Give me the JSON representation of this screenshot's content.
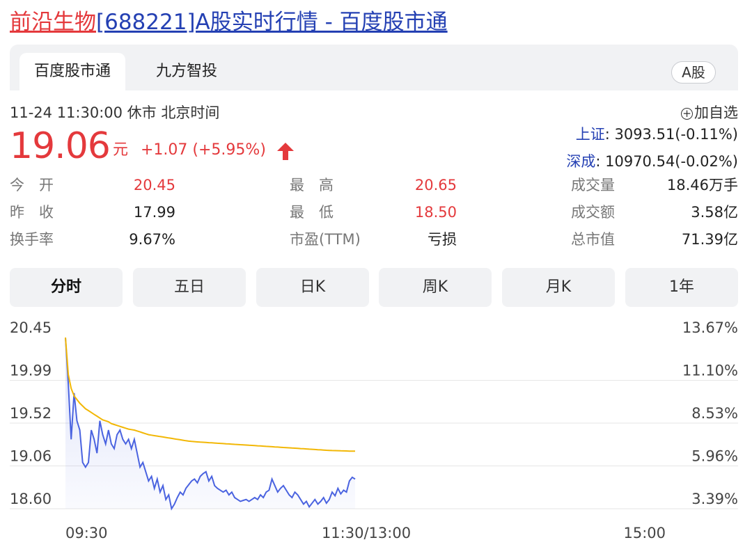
{
  "page": {
    "title_stock": "前沿生物",
    "title_rest": "[688221]A股实时行情 - 百度股市通"
  },
  "tabs": [
    {
      "label": "百度股市通",
      "active": true
    },
    {
      "label": "九方智投",
      "active": false
    }
  ],
  "market_badge": "A股",
  "quote": {
    "status_line": "11-24 11:30:00  休市  北京时间",
    "price": "19.06",
    "unit": "元",
    "change": "+1.07 (+5.95%)",
    "direction_icon": "arrow-up-icon",
    "add_watchlist": "加自选"
  },
  "indices": [
    {
      "name": "上证",
      "value": ": 3093.51(-0.11%)"
    },
    {
      "name": "深成",
      "value": ": 10970.54(-0.02%)"
    }
  ],
  "stats": [
    {
      "label": "今　开",
      "value": "20.45",
      "color": "red"
    },
    {
      "label": "最　高",
      "value": "20.65",
      "color": "red"
    },
    {
      "label": "成交量",
      "value": "18.46万手",
      "color": "black"
    },
    {
      "label": "昨　收",
      "value": "17.99",
      "color": "black"
    },
    {
      "label": "最　低",
      "value": "18.50",
      "color": "red"
    },
    {
      "label": "成交额",
      "value": "3.58亿",
      "color": "black"
    },
    {
      "label": "换手率",
      "value": "9.67%",
      "color": "black"
    },
    {
      "label": "市盈(TTM)",
      "value": "亏损",
      "color": "black"
    },
    {
      "label": "总市值",
      "value": "71.39亿",
      "color": "black"
    }
  ],
  "periods": [
    "分时",
    "五日",
    "日K",
    "周K",
    "月K",
    "1年"
  ],
  "active_period": "分时",
  "colors": {
    "up": "#e4393c",
    "price_line": "#4a63e0",
    "avg_line": "#f2b705",
    "link_blue": "#2440b3"
  },
  "chart_data": {
    "type": "line",
    "y_ticks": [
      "20.45",
      "19.99",
      "19.52",
      "19.06",
      "18.60"
    ],
    "y_pct_ticks": [
      "13.67%",
      "11.10%",
      "8.53%",
      "5.96%",
      "3.39%"
    ],
    "x_ticks": [
      "09:30",
      "11:30/13:00",
      "15:00"
    ],
    "ylim": [
      18.6,
      20.45
    ],
    "prev_close": 17.99,
    "series": [
      {
        "role": "price",
        "values": [
          20.45,
          19.95,
          19.35,
          19.85,
          19.55,
          19.45,
          19.1,
          19.05,
          19.1,
          19.45,
          19.35,
          19.2,
          19.55,
          19.4,
          19.3,
          19.45,
          19.3,
          19.25,
          19.4,
          19.45,
          19.35,
          19.3,
          19.35,
          19.25,
          19.35,
          19.2,
          19.05,
          19.1,
          19.0,
          18.9,
          18.95,
          18.82,
          18.92,
          18.78,
          18.85,
          18.7,
          18.75,
          18.6,
          18.65,
          18.72,
          18.78,
          18.75,
          18.82,
          18.86,
          18.9,
          18.92,
          18.88,
          18.95,
          18.98,
          19.0,
          18.9,
          18.95,
          18.85,
          18.82,
          18.8,
          18.78,
          18.8,
          18.75,
          18.78,
          18.72,
          18.7,
          18.68,
          18.69,
          18.7,
          18.68,
          18.7,
          18.72,
          18.7,
          18.75,
          18.72,
          18.78,
          18.8,
          18.92,
          18.85,
          18.78,
          18.82,
          18.85,
          18.8,
          18.75,
          18.72,
          18.78,
          18.75,
          18.7,
          18.65,
          18.68,
          18.62,
          18.66,
          18.7,
          18.65,
          18.68,
          18.72,
          18.66,
          18.7,
          18.78,
          18.74,
          18.82,
          18.76,
          18.8,
          18.78,
          18.9,
          18.94,
          18.92
        ],
        "x_end_fraction": 0.5
      },
      {
        "role": "average",
        "values": [
          20.45,
          20.05,
          19.9,
          19.82,
          19.78,
          19.74,
          19.71,
          19.68,
          19.66,
          19.64,
          19.62,
          19.6,
          19.58,
          19.56,
          19.55,
          19.54,
          19.52,
          19.51,
          19.5,
          19.49,
          19.48,
          19.47,
          19.46,
          19.455,
          19.45,
          19.44,
          19.43,
          19.42,
          19.41,
          19.4,
          19.395,
          19.39,
          19.385,
          19.38,
          19.375,
          19.37,
          19.365,
          19.36,
          19.355,
          19.35,
          19.345,
          19.34,
          19.335,
          19.33,
          19.327,
          19.325,
          19.322,
          19.32,
          19.318,
          19.316,
          19.314,
          19.312,
          19.31,
          19.308,
          19.306,
          19.304,
          19.302,
          19.3,
          19.298,
          19.296,
          19.294,
          19.292,
          19.29,
          19.288,
          19.286,
          19.284,
          19.282,
          19.28,
          19.278,
          19.276,
          19.274,
          19.272,
          19.27,
          19.268,
          19.266,
          19.264,
          19.262,
          19.26,
          19.258,
          19.256,
          19.254,
          19.252,
          19.25,
          19.248,
          19.246,
          19.244,
          19.242,
          19.24,
          19.238,
          19.236,
          19.234,
          19.232,
          19.23,
          19.229,
          19.228,
          19.227,
          19.226,
          19.225,
          19.224,
          19.223,
          19.222,
          19.222
        ],
        "x_end_fraction": 0.5
      }
    ]
  }
}
